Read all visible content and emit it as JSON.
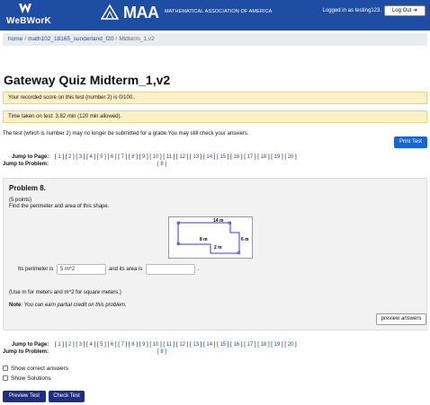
{
  "header": {
    "logo_label": "WeBWorK",
    "org_name": "MAA",
    "org_full_name": "MATHEMATICAL ASSOCIATION OF AMERICA",
    "login_status": "Logged in as testing123.",
    "logout_label": "Log Out ➜"
  },
  "breadcrumb": {
    "home": "home",
    "course": "math102_18165_sunderland_f20",
    "current": "Midterm_1,v2"
  },
  "page_title": "Gateway Quiz Midterm_1,v2",
  "alerts": {
    "score": "Your recorded score on this test (number 2) is 0/100..",
    "time": "Time taken on test: 3.82 min (120 min allowed)."
  },
  "message": "The test (which is number 2) may no longer be submitted for a grade.You may still check your answers.",
  "print_label": "Print Test",
  "jump": {
    "page_label": "Jump to Page:",
    "problem_label": "Jump to Problem:",
    "pages_prefix": "[",
    "pages": [
      "1",
      "2",
      "3",
      "4",
      "5",
      "6",
      "7",
      "8",
      "9",
      "10",
      "11",
      "12",
      "13",
      "14",
      "15",
      "16",
      "17",
      "18",
      "19",
      "20"
    ],
    "current_problem": "[ 8 ]"
  },
  "problem": {
    "title": "Problem 8.",
    "points": "(5 points)",
    "text": "Find the perimeter and area of this shape.",
    "shape_labels": {
      "top": "14 m",
      "left": "8 m",
      "right": "6 m",
      "bottom": "2 m"
    },
    "perimeter_label": "Its perimeter is",
    "perimeter_value": "5 m^2",
    "area_label": "and its area is",
    "area_value": "",
    "period": ".",
    "hint": "(Use m for meters and m^2 for square meters.)",
    "note_label": "Note",
    "note_text": ": You can earn partial credit on this problem.",
    "preview_label": "preview answers"
  },
  "options": {
    "show_correct": "Show correct answers",
    "show_solutions": "Show Solutions"
  },
  "actions": {
    "preview_test": "Preview Test",
    "check_test": "Check Test"
  },
  "colors": {
    "header_bg": "#1d4ea3",
    "alert_bg": "#fcf1c6",
    "primary_button": "#1765d1",
    "dark_button": "#1e2e82",
    "shape_stroke": "#3a3ae0"
  }
}
